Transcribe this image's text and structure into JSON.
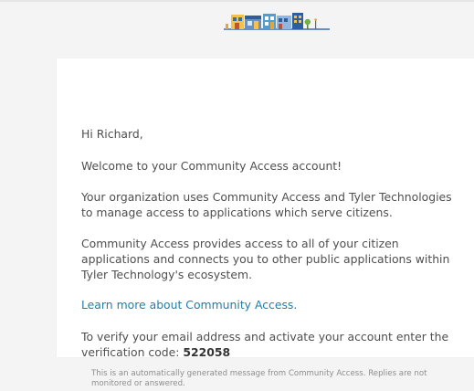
{
  "greeting": "Hi Richard,",
  "welcome": "Welcome to your Community Access account!",
  "paragraph_org": "Your organization uses Community Access and Tyler Technologies to manage access to applications which serve citizens.",
  "paragraph_provides": "Community Access provides access to all of your citizen applications and connects you to other public applications within Tyler Technology's ecosystem.",
  "learn_more_link": "Learn more about Community Access.",
  "verify_text": "To verify your email address and activate your account enter the verification code: ",
  "verification_code": "522058",
  "footer": "This is an automatically generated message from Community Access. Replies are not monitored or answered.",
  "icons": {
    "logo": "community-storefront-logo"
  },
  "colors": {
    "background": "#f4f4f4",
    "card": "#ffffff",
    "body_text": "#4f4f4f",
    "link": "#1f7eaa",
    "footer_text": "#8d8d8d"
  }
}
